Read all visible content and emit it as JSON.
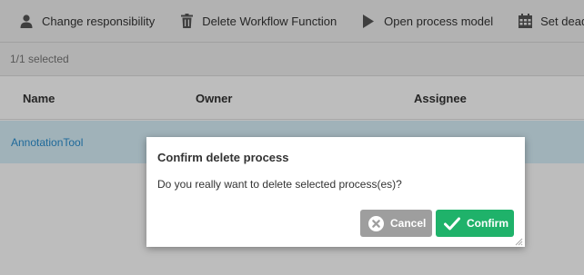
{
  "toolbar": {
    "change_responsibility": {
      "label": "Change responsibility",
      "icon": "person-icon"
    },
    "delete_workflow_function": {
      "label": "Delete Workflow Function",
      "icon": "trash-icon"
    },
    "open_process_model": {
      "label": "Open process model",
      "icon": "play-icon"
    },
    "set_deadline": {
      "label": "Set deadline",
      "icon": "calendar-icon"
    }
  },
  "selection": {
    "text": "1/1 selected"
  },
  "table": {
    "columns": [
      "Name",
      "Owner",
      "Assignee"
    ],
    "rows": [
      {
        "name": "AnnotationTool"
      }
    ]
  },
  "dialog": {
    "title": "Confirm delete process",
    "message": "Do you really want to delete selected process(es)?",
    "cancel_label": "Cancel",
    "confirm_label": "Confirm"
  },
  "colors": {
    "selected_row": "#d8f0fa",
    "link": "#2a8fd0",
    "confirm": "#1fb26a",
    "cancel": "#9e9e9e"
  }
}
